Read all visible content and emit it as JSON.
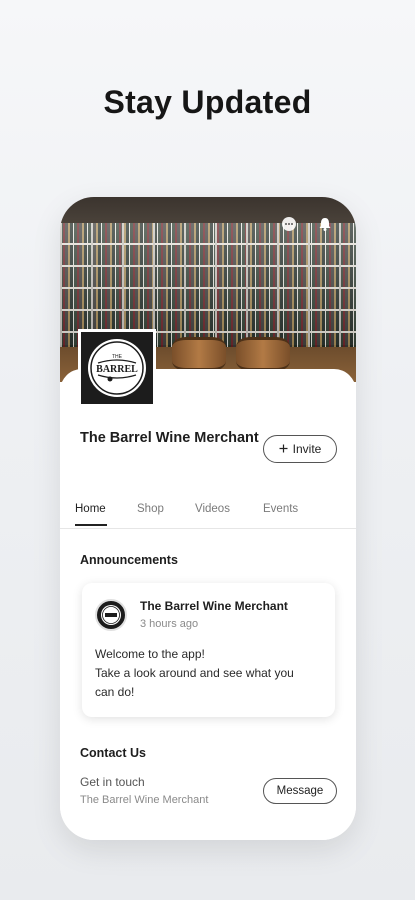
{
  "headline": "Stay Updated",
  "profile": {
    "name": "The Barrel Wine Merchant",
    "logo_text_top": "THE",
    "logo_text_main": "BARREL",
    "invite_label": "Invite"
  },
  "tabs": [
    {
      "label": "Home",
      "active": true
    },
    {
      "label": "Shop",
      "active": false
    },
    {
      "label": "Videos",
      "active": false
    },
    {
      "label": "Events",
      "active": false
    }
  ],
  "announcements": {
    "title": "Announcements",
    "post": {
      "author": "The Barrel Wine Merchant",
      "time": "3 hours ago",
      "line1": "Welcome to the app!",
      "line2": "Take a look around and see what you",
      "line3": "can do!"
    }
  },
  "contact": {
    "title": "Contact Us",
    "subtitle": "Get in touch",
    "business": "The Barrel Wine Merchant",
    "message_label": "Message"
  },
  "icons": {
    "chat": "chat-icon",
    "bell": "bell-icon",
    "plus": "plus-icon"
  },
  "colors": {
    "text_primary": "#1e1e1e",
    "text_secondary": "#8a8a8a",
    "background": "#eef0f3"
  }
}
